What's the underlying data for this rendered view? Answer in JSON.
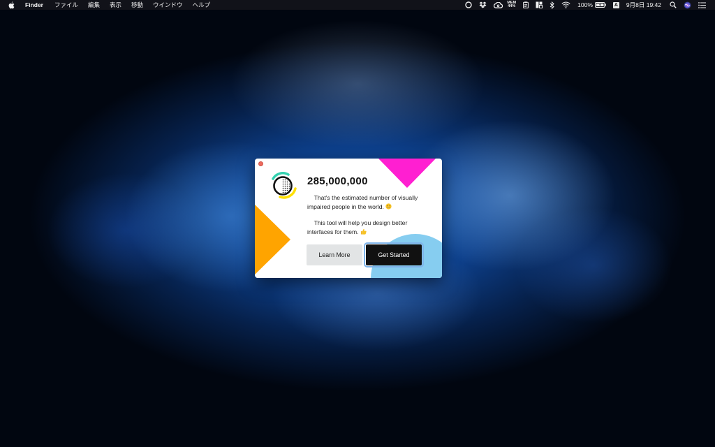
{
  "menubar": {
    "app_name": "Finder",
    "menus": [
      "ファイル",
      "編集",
      "表示",
      "移動",
      "ウインドウ",
      "ヘルプ"
    ],
    "status": {
      "mem_label": "MEM",
      "mem_value": "44%",
      "battery_percent": "100%",
      "input_source": "A",
      "datetime": "9月8日  19:42"
    },
    "icons": [
      "apple-logo-icon",
      "circle-app-icon",
      "dropbox-icon",
      "creative-cloud-icon",
      "clipboard-icon",
      "grid-layout-icon",
      "bluetooth-icon",
      "wifi-icon",
      "battery-icon",
      "spotlight-search-icon",
      "siri-icon",
      "notification-center-icon"
    ]
  },
  "dialog": {
    "headline": "285,000,000",
    "paragraph1": "That's the estimated number of visually impaired people in the world.",
    "paragraph2": "This tool will help you design better interfaces for them.",
    "learn_more_label": "Learn More",
    "get_started_label": "Get Started",
    "colors": {
      "magenta": "#ff1fd1",
      "orange": "#ffa400",
      "light_blue": "#86cdf0",
      "teal": "#35d2b0",
      "yellow": "#ffe000"
    }
  }
}
